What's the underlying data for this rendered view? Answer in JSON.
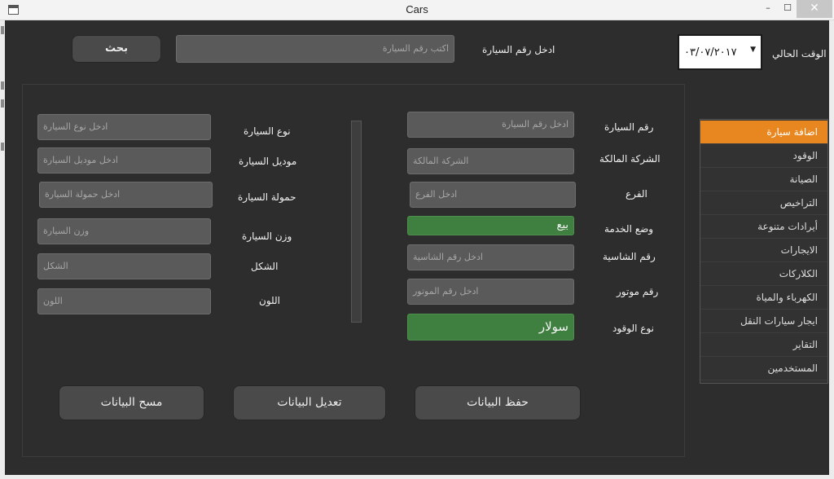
{
  "window": {
    "title": "Cars",
    "minimize": "–",
    "maximize": "☐",
    "close": "✕"
  },
  "search": {
    "label": "ادخل رقم السيارة",
    "placeholder": "اكتب رقم السيارة",
    "button": "بحث"
  },
  "current_time": {
    "label": "الوقت الحالي",
    "date_value": "٠٣/٠٧/٢٠١٧",
    "arrow": "▼"
  },
  "form_right": {
    "car_number": {
      "label": "رقم السيارة",
      "placeholder": "ادخل رقم السيارة"
    },
    "owner_company": {
      "label": "الشركة المالكة",
      "placeholder": "الشركة المالكة"
    },
    "branch": {
      "label": "الفرع",
      "placeholder": "ادخل الفرع"
    },
    "service_status": {
      "label": "وضع الخدمة",
      "value": "بيع"
    },
    "chassis_number": {
      "label": "رقم الشاسية",
      "placeholder": "ادخل رقم الشاسية"
    },
    "motor_number": {
      "label": "رقم موتور",
      "placeholder": "ادخل رقم الموتور"
    },
    "fuel_type": {
      "label": "نوع الوقود",
      "value": "سولار"
    }
  },
  "form_left": {
    "car_type": {
      "label": "نوع السيارة",
      "placeholder": "ادخل نوع السيارة"
    },
    "car_model": {
      "label": "موديل السيارة",
      "placeholder": "ادخل موديل السيارة"
    },
    "car_load": {
      "label": "حمولة السيارة",
      "placeholder": "ادخل  حمولة السيارة"
    },
    "car_weight": {
      "label": "وزن السيارة",
      "placeholder": "وزن السيارة"
    },
    "shape": {
      "label": "الشكل",
      "placeholder": "الشكل"
    },
    "color": {
      "label": "اللون",
      "placeholder": "اللون"
    }
  },
  "actions": {
    "save": "حفظ البيانات",
    "edit": "تعديل البيانات",
    "clear": "مسح البيانات"
  },
  "menu": {
    "items": [
      {
        "label": "اضافة سيارة",
        "active": true
      },
      {
        "label": "الوقود",
        "active": false
      },
      {
        "label": "الصيانة",
        "active": false
      },
      {
        "label": "التراخيص",
        "active": false
      },
      {
        "label": "أيرادات متنوعة",
        "active": false
      },
      {
        "label": "الايجارات",
        "active": false
      },
      {
        "label": "الكلاركات",
        "active": false
      },
      {
        "label": "الكهرباء والمياة",
        "active": false
      },
      {
        "label": "ايجار سيارات النقل",
        "active": false
      },
      {
        "label": "التقاير",
        "active": false
      },
      {
        "label": "المستخدمين",
        "active": false
      }
    ]
  },
  "colors": {
    "background": "#2d2d2d",
    "field": "#5a5a5a",
    "green_field": "#3f7f40",
    "menu_active": "#e8861f"
  }
}
